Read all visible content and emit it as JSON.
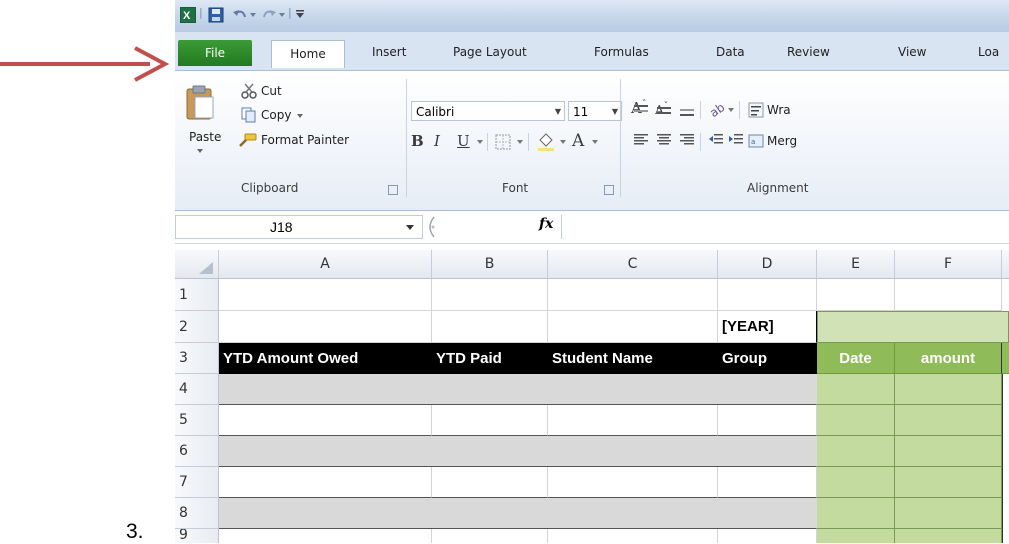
{
  "annotation": {
    "list_number": "3."
  },
  "quick_access": {
    "separator": "|"
  },
  "tabs": [
    {
      "label": "File",
      "active": false
    },
    {
      "label": "Home",
      "active": true
    },
    {
      "label": "Insert"
    },
    {
      "label": "Page Layout"
    },
    {
      "label": "Formulas"
    },
    {
      "label": "Data"
    },
    {
      "label": "Review"
    },
    {
      "label": "View"
    },
    {
      "label": "Loa"
    }
  ],
  "clipboard": {
    "paste": "Paste",
    "cut": "Cut",
    "copy": "Copy",
    "format_painter": "Format Painter",
    "group": "Clipboard"
  },
  "font": {
    "name": "Calibri",
    "size": "11",
    "bold": "B",
    "italic": "I",
    "underline": "U",
    "group": "Font",
    "grow": "A",
    "shrink": "A",
    "color_a": "A"
  },
  "alignment": {
    "wrap": "Wra",
    "merge": "Merg",
    "group": "Alignment"
  },
  "formula_bar": {
    "name_box": "J18",
    "fx": "fx"
  },
  "columns": [
    "A",
    "B",
    "C",
    "D",
    "E",
    "F"
  ],
  "rows": [
    "1",
    "2",
    "3",
    "4",
    "5",
    "6",
    "7",
    "8",
    "9"
  ],
  "cells": {
    "D2": "[YEAR]",
    "A3": "YTD Amount Owed",
    "B3": "YTD Paid",
    "C3": "Student Name",
    "D3": "Group",
    "E3": "Date",
    "F3": "amount"
  },
  "colors": {
    "arrow": "#c0504d",
    "file_tab": "#2e8b2a",
    "header_black": "#000000",
    "header_green": "#8fbc59",
    "cell_green": "#c4dba0",
    "band_gray": "#d9d9d9"
  }
}
